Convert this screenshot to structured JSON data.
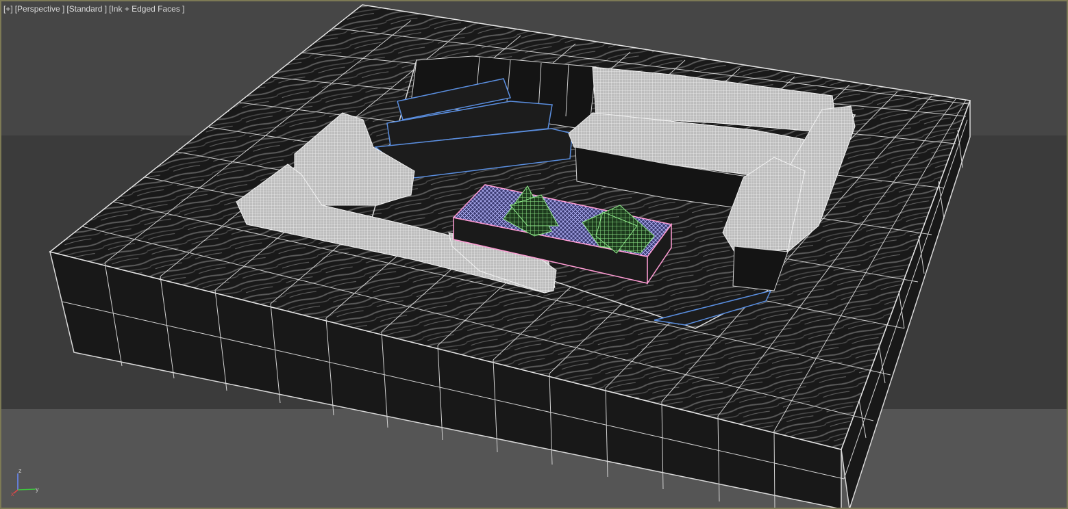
{
  "viewport": {
    "labels": {
      "plus_menu": "[+]",
      "point_of_view": "[Perspective ]",
      "shading_preset": "[Standard ]",
      "visual_style": "[Ink + Edged Faces ]"
    },
    "border_color": "#7d7a55"
  },
  "scene": {
    "objects": [
      {
        "name": "floor-platform-box",
        "color": "wireframe white on dark wood texture"
      },
      {
        "name": "sofa-left",
        "color": "white wireframe"
      },
      {
        "name": "sofa-back-right",
        "color": "white wireframe"
      },
      {
        "name": "sofa-right",
        "color": "white wireframe"
      },
      {
        "name": "fire-pit",
        "color": "pink outline"
      },
      {
        "name": "fire-wood",
        "color": "green wireframe"
      },
      {
        "name": "steps",
        "color": "blue edges"
      }
    ],
    "colors": {
      "wire": "#d9d9d9",
      "step_edges": "#5b8fe0",
      "pit_outline": "#ff9cd4",
      "wood": "#7fdc7a",
      "pit_mesh": "#a6a6ff"
    }
  },
  "axis_gizmo": {
    "z": "z",
    "x": "x",
    "y": "y",
    "x_color": "#e04848",
    "y_color": "#3fc23f",
    "z_color": "#6a8cff"
  }
}
